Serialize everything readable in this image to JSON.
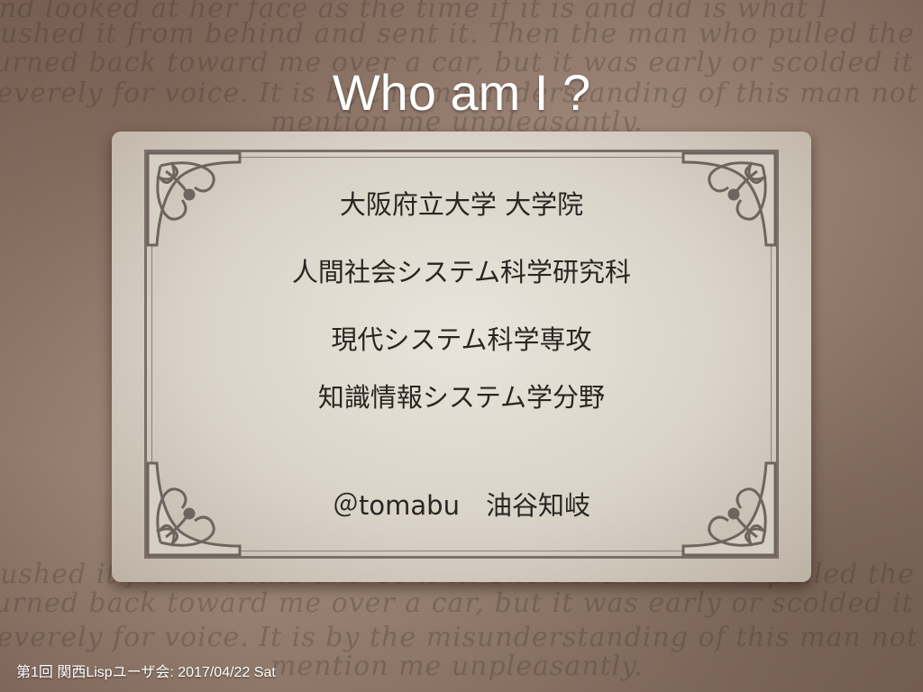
{
  "slide": {
    "title": "Who am I ?",
    "card_lines": [
      "大阪府立大学 大学院",
      "人間社会システム科学研究科",
      "現代システム科学専攻",
      "知識情報システム学分野",
      "＠tomabu　油谷知岐"
    ],
    "footer": "第1回 関西Lispユーザ会: 2017/04/22 Sat"
  },
  "background_script_lines": [
    "and looked at her face as the time if it is and did is what I",
    "pushed it from behind and sent it. Then the man who pulled the car",
    "turned back toward me over a car, but it was early or scolded it",
    "severely for voice. It is by the misunderstanding of this man not to",
    "mention me unpleasantly."
  ],
  "colors": {
    "background": "#9c8576",
    "card": "#e2dcd3",
    "frame": "#7b6f69",
    "text": "#2a2522",
    "title": "#ffffff"
  }
}
